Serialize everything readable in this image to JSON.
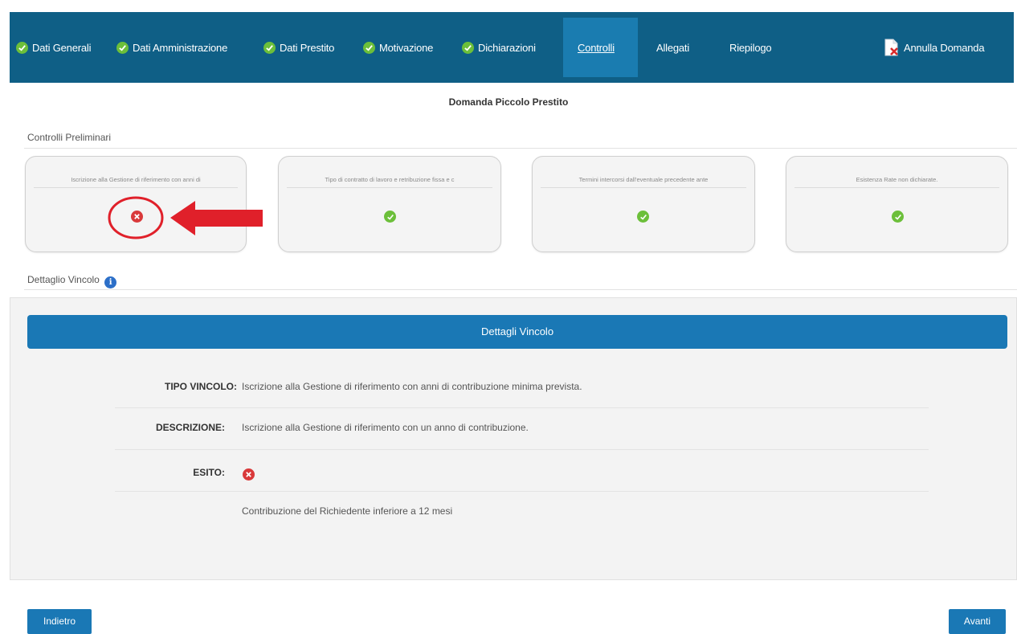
{
  "nav": {
    "tabs": [
      {
        "label": "Dati Generali",
        "done": true
      },
      {
        "label": "Dati Amministrazione",
        "done": true
      },
      {
        "label": "Dati Prestito",
        "done": true
      },
      {
        "label": "Motivazione",
        "done": true
      },
      {
        "label": "Dichiarazioni",
        "done": true
      },
      {
        "label": "Controlli",
        "active": true
      },
      {
        "label": "Allegati"
      },
      {
        "label": "Riepilogo"
      }
    ],
    "cancel_label": "Annulla Domanda"
  },
  "page_title": "Domanda Piccolo Prestito",
  "checks": {
    "section_label": "Controlli Preliminari",
    "cards": [
      {
        "text": "Iscrizione alla Gestione di riferimento con anni di",
        "status": "error"
      },
      {
        "text": "Tipo di contratto di lavoro e retribuzione fissa e c",
        "status": "ok"
      },
      {
        "text": "Termini intercorsi dall'eventuale precedente ante",
        "status": "ok"
      },
      {
        "text": "Esistenza Rate non dichiarate.",
        "status": "ok"
      }
    ]
  },
  "detail": {
    "section_label": "Dettaglio Vincolo",
    "header": "Dettagli Vincolo",
    "tipo_label": "TIPO VINCOLO:",
    "tipo_value": "Iscrizione alla Gestione di riferimento con anni di contribuzione minima prevista.",
    "descr_label": "DESCRIZIONE:",
    "descr_value": "Iscrizione alla Gestione di riferimento con un anno di contribuzione.",
    "esito_label": "ESITO:",
    "esito_status": "error",
    "esito_note": "Contribuzione del Richiedente inferiore a 12 mesi"
  },
  "buttons": {
    "back": "Indietro",
    "next": "Avanti"
  },
  "colors": {
    "nav_bg": "#0f5f86",
    "nav_active": "#1a7cb0",
    "accent": "#1a78b5",
    "ok": "#6cbf3a",
    "error": "#d9393a",
    "annotation": "#e0202a"
  }
}
